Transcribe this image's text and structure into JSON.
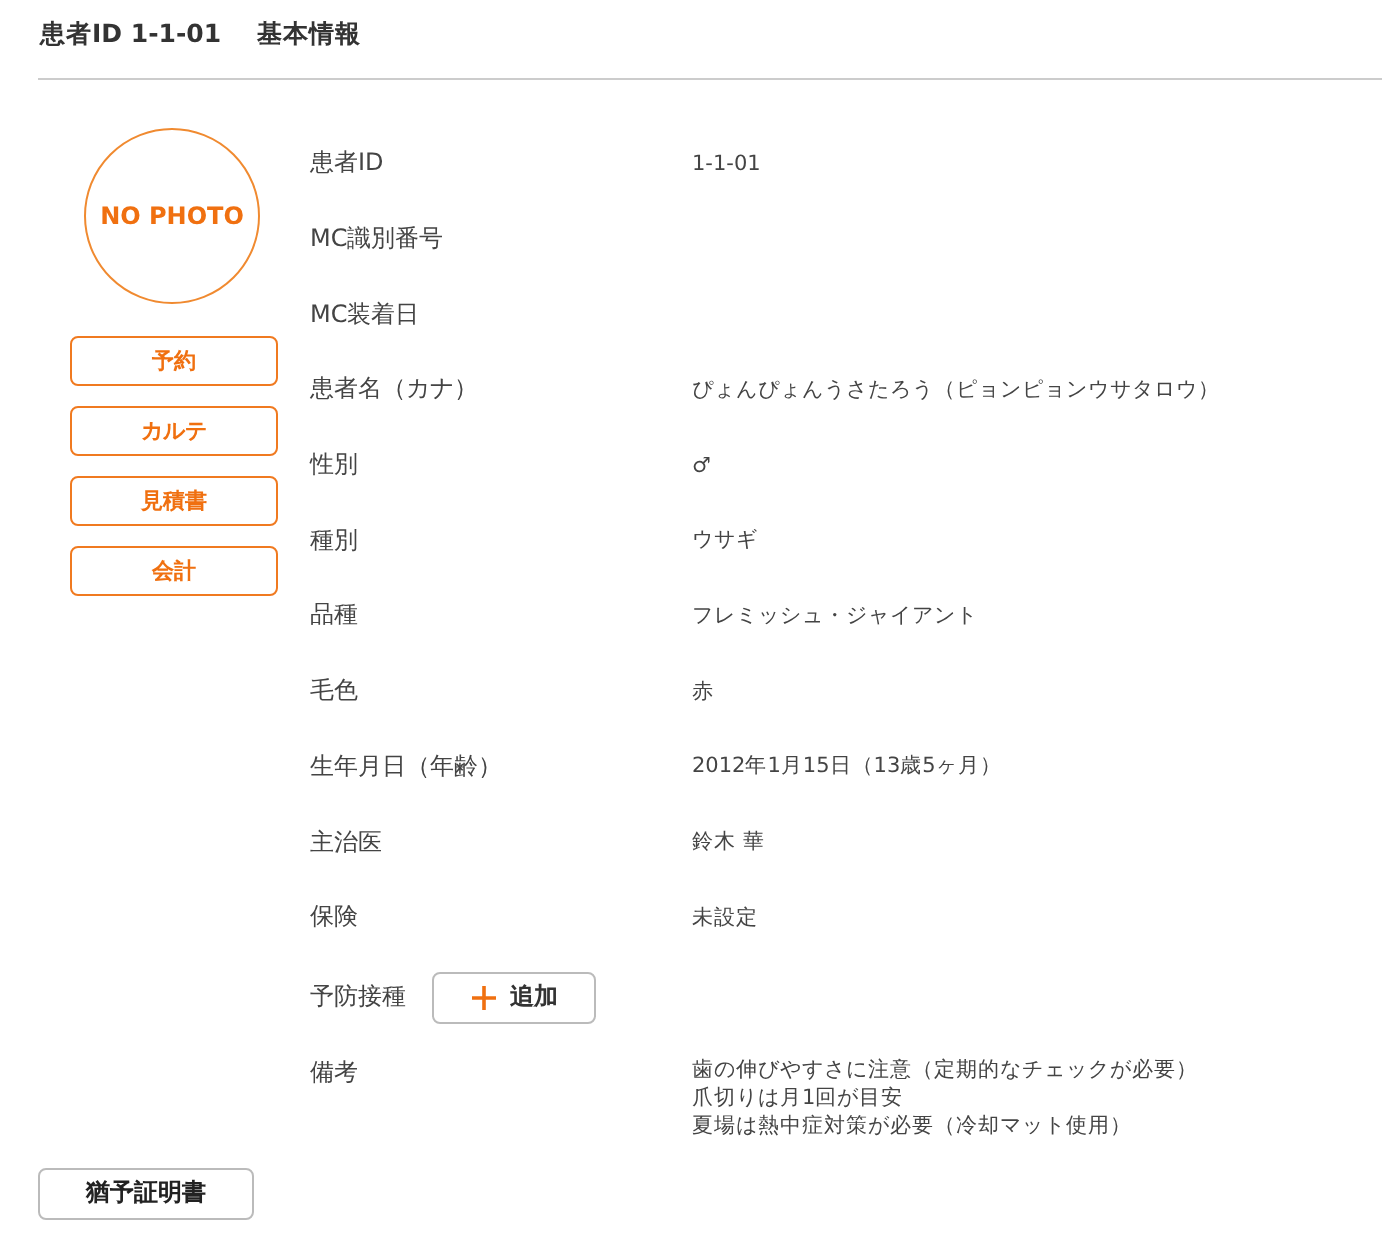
{
  "header": {
    "patient_id": "患者ID 1-1-01",
    "section": "基本情報"
  },
  "photo": {
    "placeholder": "NO PHOTO"
  },
  "side_buttons": [
    "予約",
    "カルテ",
    "見積書",
    "会計"
  ],
  "fields": [
    {
      "kind": "text",
      "label": "患者ID",
      "value": "1-1-01"
    },
    {
      "kind": "text",
      "label": "MC識別番号"
    },
    {
      "kind": "text",
      "label": "MC装着日"
    },
    {
      "kind": "text",
      "label": "患者名（カナ）",
      "value": "ぴょんぴょんうさたろう（ピョンピョンウサタロウ）"
    },
    {
      "kind": "text",
      "label": "性別",
      "value": "♂"
    },
    {
      "kind": "text",
      "label": "種別",
      "value": "ウサギ"
    },
    {
      "kind": "text",
      "label": "品種",
      "value": "フレミッシュ・ジャイアント"
    },
    {
      "kind": "text",
      "label": "毛色",
      "value": "赤"
    },
    {
      "kind": "text",
      "label": "生年月日（年齢）",
      "value": "2012年1月15日（13歳5ヶ月）"
    },
    {
      "kind": "text",
      "label": "主治医",
      "value": "鈴木 華"
    },
    {
      "kind": "text",
      "label": "保険",
      "value": "未設定"
    },
    {
      "kind": "button",
      "label": "予防接種",
      "button": "追加"
    },
    {
      "kind": "lines",
      "label": "備考",
      "lines": [
        "歯の伸びやすさに注意（定期的なチェックが必要）",
        "爪切りは月1回が目安",
        "夏場は熱中症対策が必要（冷却マット使用）"
      ]
    }
  ],
  "footer_button": "猶予証明書"
}
